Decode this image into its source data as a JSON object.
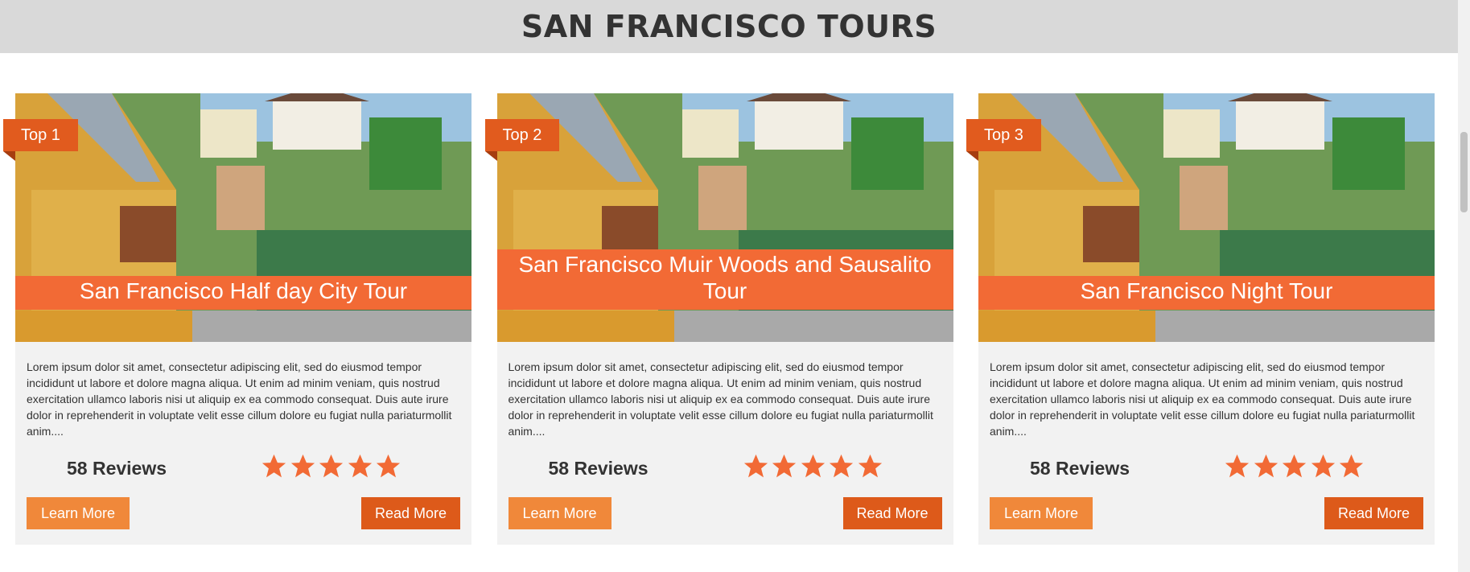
{
  "header": {
    "title": "SAN FRANCISCO TOURS"
  },
  "colors": {
    "accent": "#f26a35",
    "badge": "#e15b1e",
    "learn_button": "#f0883a",
    "read_button": "#dd5a1a",
    "header_bg": "#d9d9d9",
    "card_bg": "#f2f2f2"
  },
  "tours": [
    {
      "badge": "Top 1",
      "title": "San Francisco Half day City Tour",
      "description": "Lorem ipsum dolor sit amet, consectetur adipiscing elit, sed do eiusmod tempor incididunt ut labore et dolore magna aliqua. Ut enim ad minim veniam, quis nostrud exercitation ullamco laboris nisi ut aliquip ex ea commodo consequat. Duis aute irure dolor in reprehenderit in voluptate velit esse cillum dolore eu fugiat nulla pariaturmollit anim....",
      "reviews": "58 Reviews",
      "rating": 5,
      "learn_label": "Learn More",
      "read_label": "Read More"
    },
    {
      "badge": "Top 2",
      "title": "San Francisco Muir Woods and Sausalito Tour",
      "description": "Lorem ipsum dolor sit amet, consectetur adipiscing elit, sed do eiusmod tempor incididunt ut labore et dolore magna aliqua. Ut enim ad minim veniam, quis nostrud exercitation ullamco laboris nisi ut aliquip ex ea commodo consequat. Duis aute irure dolor in reprehenderit in voluptate velit esse cillum dolore eu fugiat nulla pariaturmollit anim....",
      "reviews": "58 Reviews",
      "rating": 5,
      "learn_label": "Learn More",
      "read_label": "Read More"
    },
    {
      "badge": "Top 3",
      "title": "San Francisco Night Tour",
      "description": "Lorem ipsum dolor sit amet, consectetur adipiscing elit, sed do eiusmod tempor incididunt ut labore et dolore magna aliqua. Ut enim ad minim veniam, quis nostrud exercitation ullamco laboris nisi ut aliquip ex ea commodo consequat. Duis aute irure dolor in reprehenderit in voluptate velit esse cillum dolore eu fugiat nulla pariaturmollit anim....",
      "reviews": "58 Reviews",
      "rating": 5,
      "learn_label": "Learn More",
      "read_label": "Read More"
    }
  ]
}
